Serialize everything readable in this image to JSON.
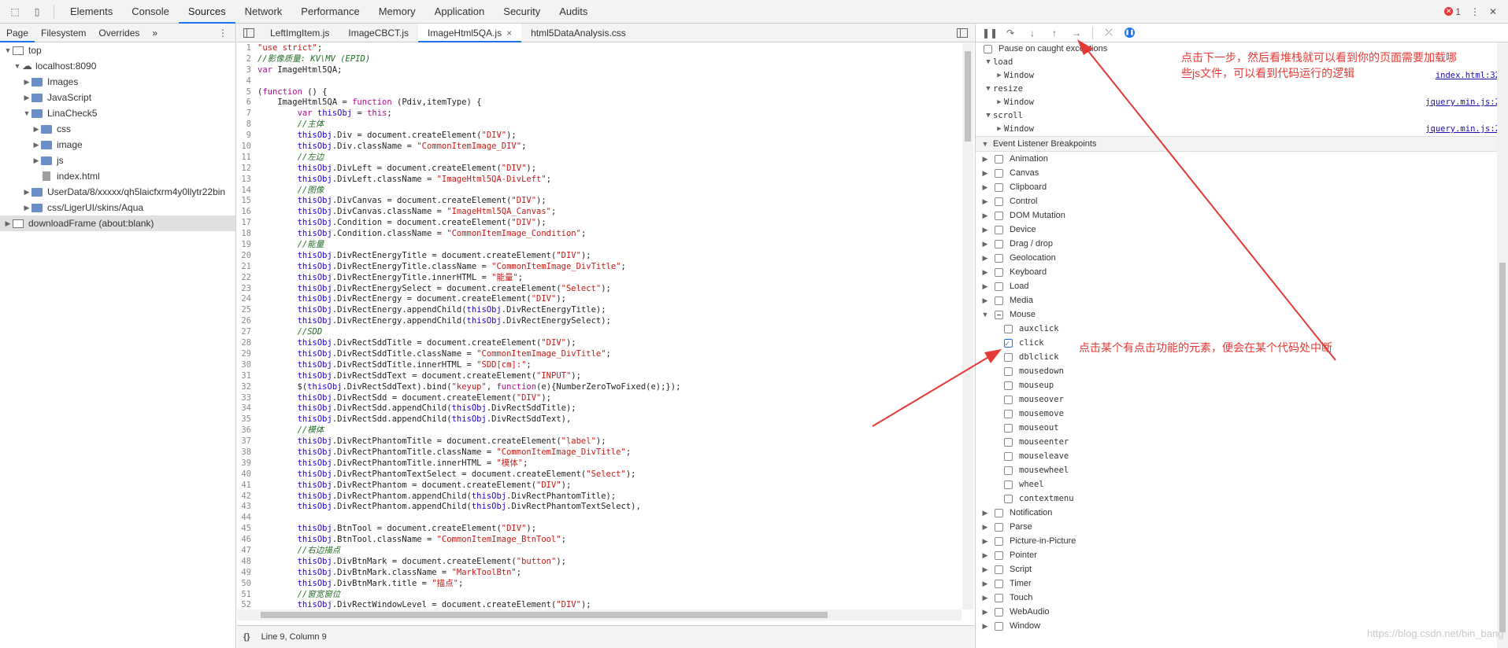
{
  "devtools": {
    "main_tabs": [
      "Elements",
      "Console",
      "Sources",
      "Network",
      "Performance",
      "Memory",
      "Application",
      "Security",
      "Audits"
    ],
    "active_main_tab": "Sources",
    "error_count": "1"
  },
  "navigator": {
    "tabs": [
      "Page",
      "Filesystem",
      "Overrides"
    ],
    "more": "»",
    "tree": [
      {
        "label": "top",
        "level": 0,
        "icon": "frame",
        "open": true
      },
      {
        "label": "localhost:8090",
        "level": 1,
        "icon": "cloud",
        "open": true
      },
      {
        "label": "Images",
        "level": 2,
        "icon": "folder",
        "open": false
      },
      {
        "label": "JavaScript",
        "level": 2,
        "icon": "folder",
        "open": false
      },
      {
        "label": "LinaCheck5",
        "level": 2,
        "icon": "folder",
        "open": true
      },
      {
        "label": "css",
        "level": 3,
        "icon": "folder",
        "open": false
      },
      {
        "label": "image",
        "level": 3,
        "icon": "folder",
        "open": false
      },
      {
        "label": "js",
        "level": 3,
        "icon": "folder",
        "open": false
      },
      {
        "label": "index.html",
        "level": 3,
        "icon": "file",
        "open": null
      },
      {
        "label": "UserData/8/xxxxx/qh5laicfxrm4y0llytr22bin",
        "level": 2,
        "icon": "folder",
        "open": false
      },
      {
        "label": "css/LigerUI/skins/Aqua",
        "level": 2,
        "icon": "folder",
        "open": false
      },
      {
        "label": "downloadFrame (about:blank)",
        "level": 0,
        "icon": "frame",
        "open": false,
        "selected": true
      }
    ]
  },
  "editor": {
    "tabs": [
      "LeftImgItem.js",
      "ImageCBCT.js",
      "ImageHtml5QA.js",
      "html5DataAnalysis.css"
    ],
    "active_tab": "ImageHtml5QA.js",
    "close_glyph": "×",
    "status": "Line 9, Column 9",
    "status_icon": "{}",
    "lines": [
      "\"use strict\";",
      "//影像质量: KV\\MV (EPID)",
      "var ImageHtml5QA;",
      "",
      "(function () {",
      "    ImageHtml5QA = function (Pdiv,itemType) {",
      "        var thisObj = this;",
      "        //主体",
      "        thisObj.Div = document.createElement(\"DIV\");",
      "        thisObj.Div.className = \"CommonItemImage_DIV\";",
      "        //左边",
      "        thisObj.DivLeft = document.createElement(\"DIV\");",
      "        thisObj.DivLeft.className = \"ImageHtml5QA-DivLeft\";",
      "        //图像",
      "        thisObj.DivCanvas = document.createElement(\"DIV\");",
      "        thisObj.DivCanvas.className = \"ImageHtml5QA_Canvas\";",
      "        thisObj.Condition = document.createElement(\"DIV\");",
      "        thisObj.Condition.className = \"CommonItemImage_Condition\";",
      "        //能量",
      "        thisObj.DivRectEnergyTitle = document.createElement(\"DIV\");",
      "        thisObj.DivRectEnergyTitle.className = \"CommonItemImage_DivTitle\";",
      "        thisObj.DivRectEnergyTitle.innerHTML = \"能量\";",
      "        thisObj.DivRectEnergySelect = document.createElement(\"Select\");",
      "        thisObj.DivRectEnergy = document.createElement(\"DIV\");",
      "        thisObj.DivRectEnergy.appendChild(thisObj.DivRectEnergyTitle);",
      "        thisObj.DivRectEnergy.appendChild(thisObj.DivRectEnergySelect);",
      "        //SDD",
      "        thisObj.DivRectSddTitle = document.createElement(\"DIV\");",
      "        thisObj.DivRectSddTitle.className = \"CommonItemImage_DivTitle\";",
      "        thisObj.DivRectSddTitle.innerHTML = \"SDD[cm]:\";",
      "        thisObj.DivRectSddText = document.createElement(\"INPUT\");",
      "        $(thisObj.DivRectSddText).bind(\"keyup\", function(e){NumberZeroTwoFixed(e);});",
      "        thisObj.DivRectSdd = document.createElement(\"DIV\");",
      "        thisObj.DivRectSdd.appendChild(thisObj.DivRectSddTitle);",
      "        thisObj.DivRectSdd.appendChild(thisObj.DivRectSddText),",
      "        //模体",
      "        thisObj.DivRectPhantomTitle = document.createElement(\"label\");",
      "        thisObj.DivRectPhantomTitle.className = \"CommonItemImage_DivTitle\";",
      "        thisObj.DivRectPhantomTitle.innerHTML = \"模体\";",
      "        thisObj.DivRectPhantomTextSelect = document.createElement(\"Select\");",
      "        thisObj.DivRectPhantom = document.createElement(\"DIV\");",
      "        thisObj.DivRectPhantom.appendChild(thisObj.DivRectPhantomTitle);",
      "        thisObj.DivRectPhantom.appendChild(thisObj.DivRectPhantomTextSelect),",
      "",
      "        thisObj.BtnTool = document.createElement(\"DIV\");",
      "        thisObj.BtnTool.className = \"CommonItemImage_BtnTool\";",
      "        //右边描点",
      "        thisObj.DivBtnMark = document.createElement(\"button\");",
      "        thisObj.DivBtnMark.className = \"MarkToolBtn\";",
      "        thisObj.DivBtnMark.title = \"描点\";",
      "        //窗宽窗位",
      "        thisObj.DivRectWindowLevel = document.createElement(\"DIV\");",
      ""
    ]
  },
  "debugger": {
    "pause_on_caught": "Pause on caught exceptions",
    "listeners": [
      {
        "event": "load",
        "target": "Window",
        "source": "index.html:32"
      },
      {
        "event": "resize",
        "target": "Window",
        "source": "jquery.min.js:2"
      },
      {
        "event": "scroll",
        "target": "Window",
        "source": "jquery.min.js:2"
      }
    ],
    "elb_title": "Event Listener Breakpoints",
    "categories_before": [
      "Animation",
      "Canvas",
      "Clipboard",
      "Control",
      "DOM Mutation",
      "Device",
      "Drag / drop",
      "Geolocation",
      "Keyboard",
      "Load",
      "Media"
    ],
    "mouse_label": "Mouse",
    "mouse_events": [
      {
        "name": "auxclick",
        "checked": false
      },
      {
        "name": "click",
        "checked": true
      },
      {
        "name": "dblclick",
        "checked": false
      },
      {
        "name": "mousedown",
        "checked": false
      },
      {
        "name": "mouseup",
        "checked": false
      },
      {
        "name": "mouseover",
        "checked": false
      },
      {
        "name": "mousemove",
        "checked": false
      },
      {
        "name": "mouseout",
        "checked": false
      },
      {
        "name": "mouseenter",
        "checked": false
      },
      {
        "name": "mouseleave",
        "checked": false
      },
      {
        "name": "mousewheel",
        "checked": false
      },
      {
        "name": "wheel",
        "checked": false
      },
      {
        "name": "contextmenu",
        "checked": false
      }
    ],
    "categories_after": [
      "Notification",
      "Parse",
      "Picture-in-Picture",
      "Pointer",
      "Script",
      "Timer",
      "Touch",
      "WebAudio",
      "Window"
    ]
  },
  "annotations": {
    "top_note_line1": "点击下一步，然后看堆栈就可以看到你的页面需要加载哪",
    "top_note_line2": "些js文件，可以看到代码运行的逻辑",
    "mid_note": "点击某个有点击功能的元素，便会在某个代码处中断",
    "color": "#e53935"
  },
  "watermark": "https://blog.csdn.net/bin_bang"
}
